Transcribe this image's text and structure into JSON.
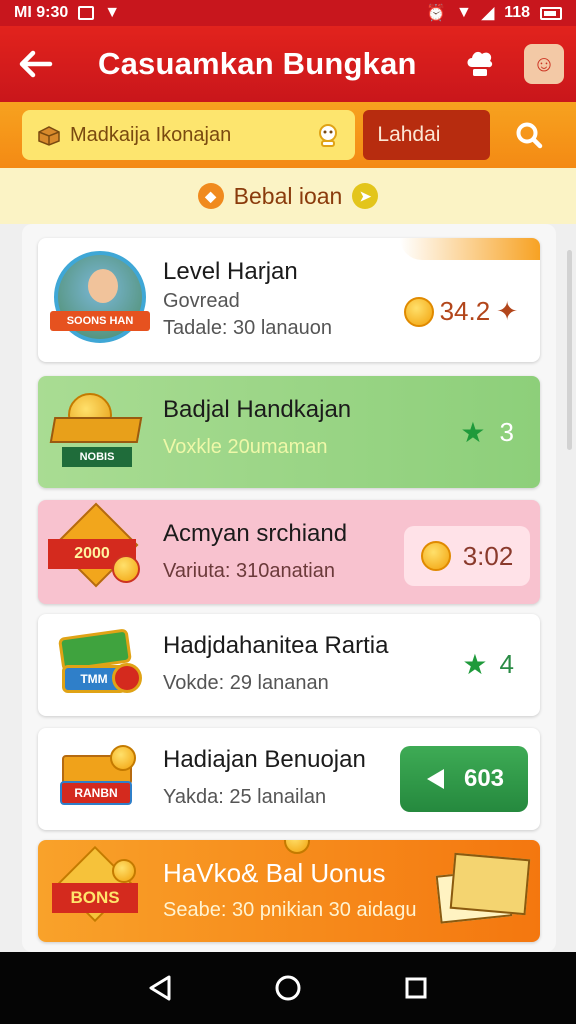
{
  "status_bar": {
    "left_text": "MI 9:30",
    "right_text": "118"
  },
  "app_bar": {
    "title": "Casuamkan Bungkan"
  },
  "search": {
    "text": "Madkaija Ikonajan",
    "category": "Lahdai"
  },
  "section": {
    "label": "Bebal ioan"
  },
  "cards": [
    {
      "badge": "SOONS HAN",
      "title": "Level Harjan",
      "subtitle": "Govread",
      "detail": "Tadale: 30 lanauon",
      "value": "34.2"
    },
    {
      "badge": "NOBIS",
      "title": "Badjal Handkajan",
      "subtitle": "Voxkle  20umaman",
      "value": "3"
    },
    {
      "badge": "2000",
      "title": "Acmyan srchiand",
      "subtitle": "Variuta: 310anatian",
      "value": "3:02"
    },
    {
      "badge": "TMM",
      "title": "Hadjdahanitea Rartia",
      "subtitle": "Vokde: 29 lananan",
      "value": "4"
    },
    {
      "badge": "RANBN",
      "title": "Hadiajan Benuojan",
      "subtitle": "Yakda: 25 lanailan",
      "value": "603"
    },
    {
      "badge": "BONS",
      "title": "HaVko& Bal Uonus",
      "subtitle": "Seabe: 30 pnikian 30 aidagu"
    }
  ],
  "colors": {
    "primary": "#d31b1d",
    "accent": "#f6951a",
    "green": "#1f9a3b",
    "pink": "#f8c4d0"
  }
}
